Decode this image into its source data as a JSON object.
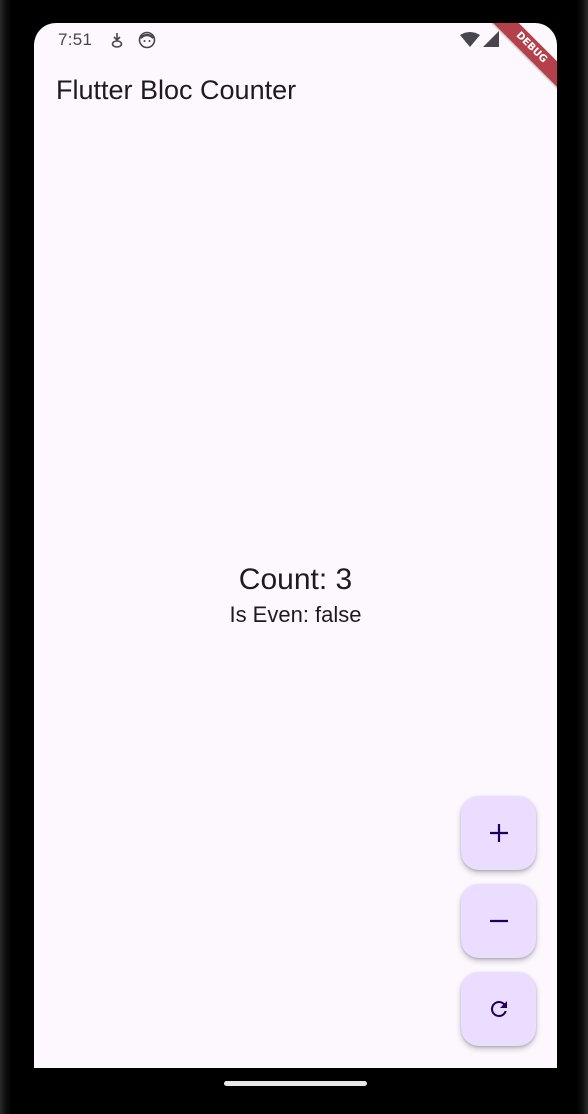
{
  "status_bar": {
    "time": "7:51",
    "icons_left": [
      "download-icon",
      "face-icon"
    ],
    "icons_right": [
      "wifi-icon",
      "cell-signal-icon"
    ]
  },
  "debug_banner": "DEBUG",
  "app_bar": {
    "title": "Flutter Bloc Counter"
  },
  "counter": {
    "count_text": "Count: 3",
    "even_text": "Is Even: false"
  },
  "fabs": [
    {
      "icon": "plus-icon"
    },
    {
      "icon": "minus-icon"
    },
    {
      "icon": "refresh-icon"
    }
  ],
  "colors": {
    "background": "#fdf7fe",
    "fab": "#eaddff",
    "fab_icon": "#21005d",
    "text": "#1d1b20",
    "debug_banner": "#b3404a"
  }
}
